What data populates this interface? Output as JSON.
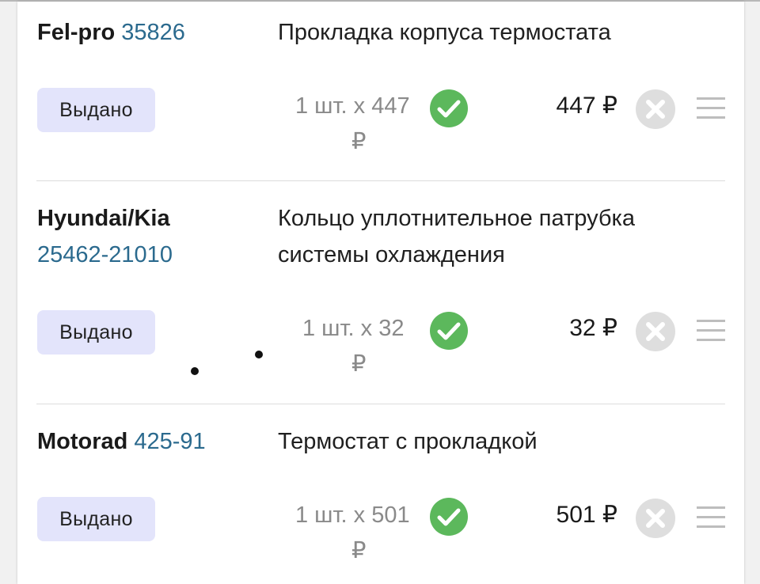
{
  "colors": {
    "status_bg": "#e3e4fb",
    "check": "#5cb85c",
    "code": "#2b6a8e",
    "remove": "#dedede",
    "menu": "#bdbdbd"
  },
  "items": [
    {
      "brand": "Fel-pro",
      "code": "35826",
      "name": "Прокладка корпуса термостата",
      "status": "Выдано",
      "qty": "1 шт. x 447",
      "currency": "₽",
      "total": "447 ₽",
      "check_icon": "check-circle-icon",
      "remove_icon": "remove-circle-icon",
      "menu_icon": "menu-lines-icon"
    },
    {
      "brand": "Hyundai/Kia",
      "code": "25462-21010",
      "name": "Кольцо уплотнительное патрубка системы охлаждения",
      "status": "Выдано",
      "qty": "1 шт. x 32",
      "currency": "₽",
      "total": "32 ₽",
      "check_icon": "check-circle-icon",
      "remove_icon": "remove-circle-icon",
      "menu_icon": "menu-lines-icon"
    },
    {
      "brand": "Motorad",
      "code": "425-91",
      "name": "Термостат с прокладкой",
      "status": "Выдано",
      "qty": "1 шт. x 501",
      "currency": "₽",
      "total": "501 ₽",
      "check_icon": "check-circle-icon",
      "remove_icon": "remove-circle-icon",
      "menu_icon": "menu-lines-icon"
    }
  ]
}
